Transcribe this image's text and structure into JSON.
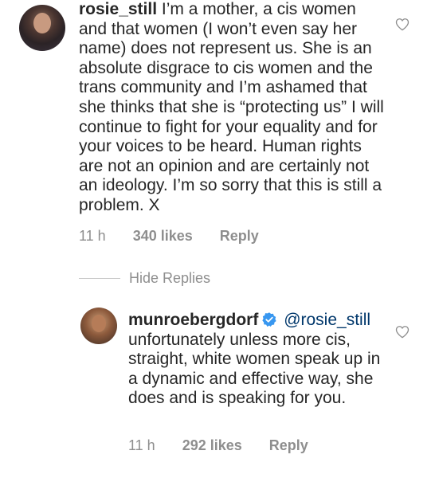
{
  "comments": [
    {
      "username": "rosie_still",
      "text": "I’m a mother, a cis women and that women (I won’t even say her name) does not represent us. She is an absolute disgrace to cis women and the trans community and I’m ashamed that she thinks that she is “protecting us” I will continue to fight for your equality and for your voices to be heard. Human rights are not an opinion and are certainly not an ideology. I’m so sorry that this is still a problem. X",
      "time": "11 h",
      "likes": "340 likes",
      "reply_label": "Reply"
    }
  ],
  "hide_replies_label": "Hide Replies",
  "replies": [
    {
      "username": "munroebergdorf",
      "verified": true,
      "mention": "@rosie_still",
      "text": "unfortunately unless more cis, straight, white women speak up in a dynamic and effective way, she does and is speaking for you.",
      "time": "11 h",
      "likes": "292 likes",
      "reply_label": "Reply"
    }
  ],
  "colors": {
    "text": "#262626",
    "meta": "#8e8e8e",
    "mention": "#00376b",
    "verified": "#3897f0"
  }
}
